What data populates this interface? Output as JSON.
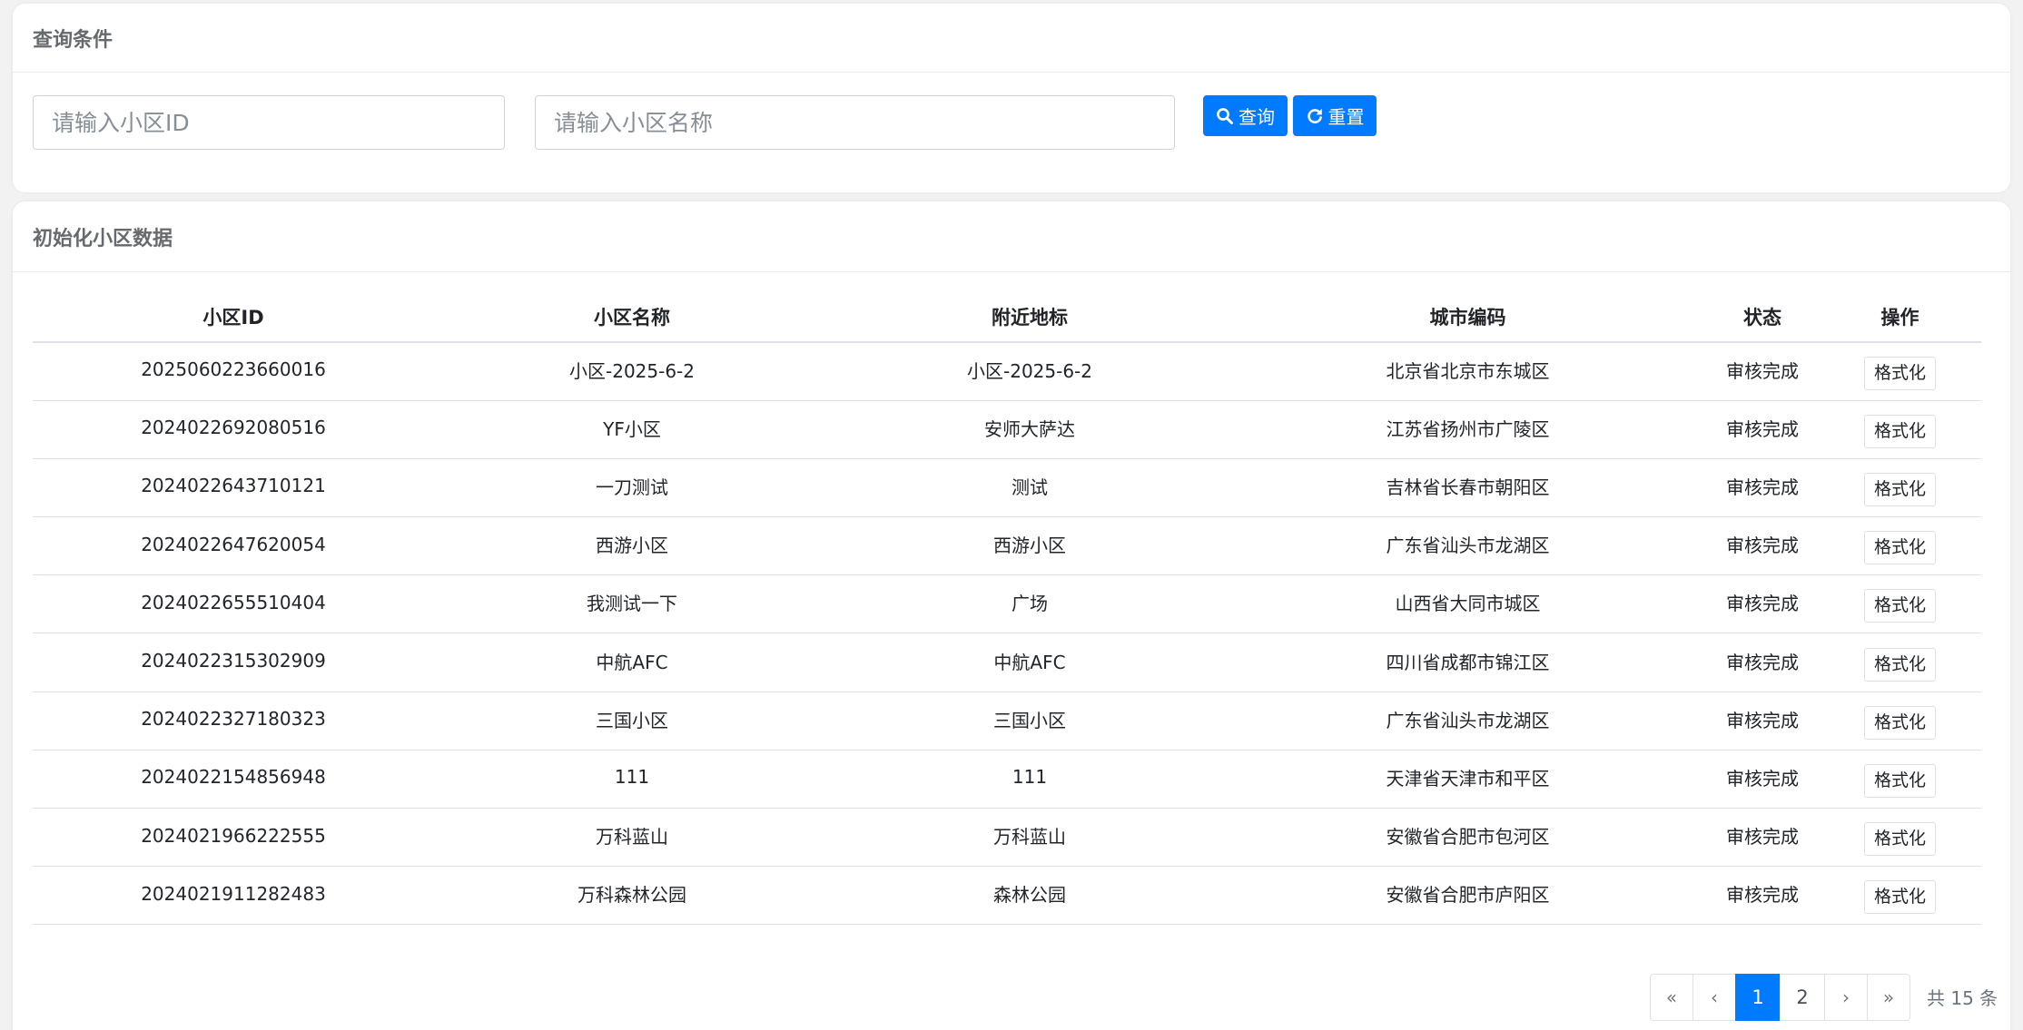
{
  "query": {
    "title": "查询条件",
    "community_id_placeholder": "请输入小区ID",
    "community_name_placeholder": "请输入小区名称",
    "search_label": "查询",
    "reset_label": "重置"
  },
  "data_panel": {
    "title": "初始化小区数据",
    "columns": [
      "小区ID",
      "小区名称",
      "附近地标",
      "城市编码",
      "状态",
      "操作"
    ],
    "rows": [
      {
        "id": "2025060223660016",
        "name": "小区-2025-6-2",
        "landmark": "小区-2025-6-2",
        "city": "北京省北京市东城区",
        "status": "审核完成",
        "action": "格式化"
      },
      {
        "id": "2024022692080516",
        "name": "YF小区",
        "landmark": "安师大萨达",
        "city": "江苏省扬州市广陵区",
        "status": "审核完成",
        "action": "格式化"
      },
      {
        "id": "2024022643710121",
        "name": "一刀测试",
        "landmark": "测试",
        "city": "吉林省长春市朝阳区",
        "status": "审核完成",
        "action": "格式化"
      },
      {
        "id": "2024022647620054",
        "name": "西游小区",
        "landmark": "西游小区",
        "city": "广东省汕头市龙湖区",
        "status": "审核完成",
        "action": "格式化"
      },
      {
        "id": "2024022655510404",
        "name": "我测试一下",
        "landmark": "广场",
        "city": "山西省大同市城区",
        "status": "审核完成",
        "action": "格式化"
      },
      {
        "id": "2024022315302909",
        "name": "中航AFC",
        "landmark": "中航AFC",
        "city": "四川省成都市锦江区",
        "status": "审核完成",
        "action": "格式化"
      },
      {
        "id": "2024022327180323",
        "name": "三国小区",
        "landmark": "三国小区",
        "city": "广东省汕头市龙湖区",
        "status": "审核完成",
        "action": "格式化"
      },
      {
        "id": "2024022154856948",
        "name": "111",
        "landmark": "111",
        "city": "天津省天津市和平区",
        "status": "审核完成",
        "action": "格式化"
      },
      {
        "id": "2024021966222555",
        "name": "万科蓝山",
        "landmark": "万科蓝山",
        "city": "安徽省合肥市包河区",
        "status": "审核完成",
        "action": "格式化"
      },
      {
        "id": "2024021911282483",
        "name": "万科森林公园",
        "landmark": "森林公园",
        "city": "安徽省合肥市庐阳区",
        "status": "审核完成",
        "action": "格式化"
      }
    ]
  },
  "pagination": {
    "first": "«",
    "prev": "‹",
    "pages": [
      "1",
      "2"
    ],
    "current_page": "1",
    "next": "›",
    "last": "»",
    "total": "共 15 条"
  },
  "icons": {
    "search": "search-icon",
    "reset": "refresh-icon"
  },
  "colors": {
    "primary": "#007bff",
    "background": "#f2f2f2",
    "panel": "#ffffff",
    "title_text": "#676a6c"
  }
}
